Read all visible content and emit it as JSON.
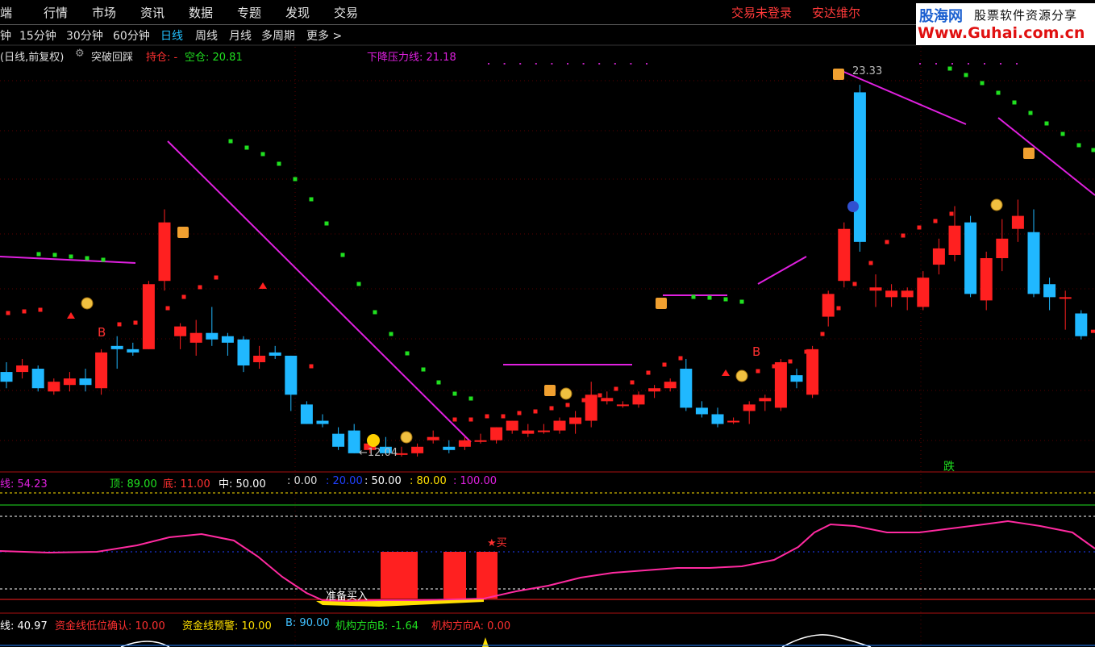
{
  "menu": {
    "items": [
      "端",
      "行情",
      "市场",
      "资讯",
      "数据",
      "专题",
      "发现",
      "交易"
    ],
    "status": [
      "交易未登录",
      "安达维尔"
    ]
  },
  "logo": {
    "name": "股海网",
    "slogan": "股票软件资源分享",
    "url": "Www.Guhai.com.cn"
  },
  "periods": {
    "items": [
      "钟",
      "15分钟",
      "30分钟",
      "60分钟",
      "日线",
      "周线",
      "月线",
      "多周期",
      "更多 >"
    ],
    "active": "日线"
  },
  "main_chart": {
    "header": {
      "title": "(日线,前复权)",
      "indicator": "突破回踩",
      "hold": "持仓: -",
      "empty": "空仓: 20.81",
      "pressure": "下降压力线: 21.18"
    },
    "high_label": "23.33",
    "low_label": "←12.04",
    "fall_label": "跌",
    "b_label": "B"
  },
  "sub1": {
    "labels": [
      "线: 54.23",
      "顶: 89.00",
      "底: 11.00",
      "中: 50.00",
      ": 0.00",
      ": 20.00",
      ": 50.00",
      ": 80.00",
      ": 100.00"
    ],
    "prep_label": "准备买入",
    "buy_label": "★买"
  },
  "sub2": {
    "labels": [
      "线: 40.97",
      "资金线低位确认: 10.00",
      "资金线预警: 10.00",
      "B: 90.00",
      "机构方向B: -1.64",
      "机构方向A: 0.00"
    ]
  },
  "colors": {
    "up": "#ff2020",
    "down": "#20b8ff",
    "magenta": "#e020e0",
    "green": "#20e020",
    "cyan": "#40c0ff",
    "bg": "#000000"
  },
  "chart_data": {
    "type": "candlestick",
    "title": "",
    "ylim": [
      11.5,
      24.5
    ],
    "candles": [
      {
        "o": 14.5,
        "h": 14.8,
        "l": 14.0,
        "c": 14.2
      },
      {
        "o": 14.5,
        "h": 14.9,
        "l": 14.3,
        "c": 14.7
      },
      {
        "o": 14.6,
        "h": 14.7,
        "l": 13.9,
        "c": 14.0
      },
      {
        "o": 13.9,
        "h": 14.3,
        "l": 13.8,
        "c": 14.2
      },
      {
        "o": 14.1,
        "h": 14.5,
        "l": 13.9,
        "c": 14.3
      },
      {
        "o": 14.3,
        "h": 14.6,
        "l": 13.9,
        "c": 14.1
      },
      {
        "o": 14.0,
        "h": 15.2,
        "l": 13.8,
        "c": 15.1
      },
      {
        "o": 15.3,
        "h": 15.6,
        "l": 14.6,
        "c": 15.2
      },
      {
        "o": 15.2,
        "h": 15.4,
        "l": 15.0,
        "c": 15.1
      },
      {
        "o": 15.2,
        "h": 17.3,
        "l": 15.2,
        "c": 17.2
      },
      {
        "o": 17.3,
        "h": 19.5,
        "l": 17.0,
        "c": 19.1
      },
      {
        "o": 15.6,
        "h": 16.0,
        "l": 15.2,
        "c": 15.9
      },
      {
        "o": 15.4,
        "h": 16.1,
        "l": 15.0,
        "c": 15.7
      },
      {
        "o": 15.7,
        "h": 16.5,
        "l": 15.3,
        "c": 15.5
      },
      {
        "o": 15.6,
        "h": 15.7,
        "l": 15.0,
        "c": 15.4
      },
      {
        "o": 15.5,
        "h": 15.6,
        "l": 14.5,
        "c": 14.7
      },
      {
        "o": 14.8,
        "h": 15.3,
        "l": 14.6,
        "c": 15.0
      },
      {
        "o": 15.1,
        "h": 15.3,
        "l": 14.9,
        "c": 15.0
      },
      {
        "o": 15.0,
        "h": 15.0,
        "l": 13.3,
        "c": 13.8
      },
      {
        "o": 13.5,
        "h": 13.6,
        "l": 12.9,
        "c": 12.9
      },
      {
        "o": 13.0,
        "h": 13.2,
        "l": 12.8,
        "c": 12.9
      },
      {
        "o": 12.6,
        "h": 12.8,
        "l": 12.1,
        "c": 12.2
      },
      {
        "o": 12.7,
        "h": 12.9,
        "l": 12.0,
        "c": 12.0
      },
      {
        "o": 12.1,
        "h": 12.4,
        "l": 12.0,
        "c": 12.3
      },
      {
        "o": 12.2,
        "h": 12.5,
        "l": 12.0,
        "c": 12.0
      },
      {
        "o": 12.0,
        "h": 12.2,
        "l": 11.9,
        "c": 12.0
      },
      {
        "o": 12.0,
        "h": 12.3,
        "l": 11.9,
        "c": 12.2
      },
      {
        "o": 12.4,
        "h": 12.7,
        "l": 12.3,
        "c": 12.5
      },
      {
        "o": 12.2,
        "h": 12.4,
        "l": 12.0,
        "c": 12.1
      },
      {
        "o": 12.2,
        "h": 12.5,
        "l": 12.1,
        "c": 12.4
      },
      {
        "o": 12.4,
        "h": 12.6,
        "l": 12.3,
        "c": 12.4
      },
      {
        "o": 12.4,
        "h": 12.8,
        "l": 12.3,
        "c": 12.8
      },
      {
        "o": 12.7,
        "h": 13.0,
        "l": 12.6,
        "c": 13.0
      },
      {
        "o": 12.6,
        "h": 12.9,
        "l": 12.5,
        "c": 12.7
      },
      {
        "o": 12.7,
        "h": 12.9,
        "l": 12.6,
        "c": 12.7
      },
      {
        "o": 12.7,
        "h": 13.1,
        "l": 12.6,
        "c": 13.0
      },
      {
        "o": 12.9,
        "h": 13.3,
        "l": 12.6,
        "c": 13.1
      },
      {
        "o": 13.0,
        "h": 14.2,
        "l": 12.8,
        "c": 13.8
      },
      {
        "o": 13.6,
        "h": 13.9,
        "l": 13.5,
        "c": 13.7
      },
      {
        "o": 13.5,
        "h": 13.6,
        "l": 13.4,
        "c": 13.5
      },
      {
        "o": 13.5,
        "h": 13.9,
        "l": 13.4,
        "c": 13.8
      },
      {
        "o": 13.9,
        "h": 14.1,
        "l": 13.7,
        "c": 14.0
      },
      {
        "o": 14.0,
        "h": 14.3,
        "l": 13.9,
        "c": 14.2
      },
      {
        "o": 14.6,
        "h": 14.9,
        "l": 13.3,
        "c": 13.4
      },
      {
        "o": 13.4,
        "h": 13.6,
        "l": 13.1,
        "c": 13.2
      },
      {
        "o": 13.2,
        "h": 13.4,
        "l": 12.8,
        "c": 12.9
      },
      {
        "o": 13.0,
        "h": 13.1,
        "l": 12.9,
        "c": 13.0
      },
      {
        "o": 13.3,
        "h": 13.6,
        "l": 12.9,
        "c": 13.5
      },
      {
        "o": 13.6,
        "h": 13.8,
        "l": 13.3,
        "c": 13.7
      },
      {
        "o": 13.4,
        "h": 14.9,
        "l": 13.3,
        "c": 14.8
      },
      {
        "o": 14.4,
        "h": 14.6,
        "l": 14.0,
        "c": 14.2
      },
      {
        "o": 13.8,
        "h": 15.3,
        "l": 13.7,
        "c": 15.2
      },
      {
        "o": 16.2,
        "h": 17.0,
        "l": 15.9,
        "c": 16.9
      },
      {
        "o": 17.3,
        "h": 19.1,
        "l": 17.1,
        "c": 18.9
      },
      {
        "o": 23.1,
        "h": 23.33,
        "l": 18.2,
        "c": 18.5
      },
      {
        "o": 17.0,
        "h": 17.5,
        "l": 16.5,
        "c": 17.1
      },
      {
        "o": 16.8,
        "h": 17.2,
        "l": 16.5,
        "c": 17.0
      },
      {
        "o": 16.8,
        "h": 17.1,
        "l": 16.4,
        "c": 17.0
      },
      {
        "o": 16.5,
        "h": 17.6,
        "l": 16.4,
        "c": 17.4
      },
      {
        "o": 17.8,
        "h": 18.6,
        "l": 17.5,
        "c": 18.3
      },
      {
        "o": 18.1,
        "h": 19.6,
        "l": 17.9,
        "c": 19.0
      },
      {
        "o": 19.1,
        "h": 19.3,
        "l": 16.8,
        "c": 16.9
      },
      {
        "o": 16.7,
        "h": 18.2,
        "l": 16.4,
        "c": 18.0
      },
      {
        "o": 18.0,
        "h": 19.2,
        "l": 17.6,
        "c": 18.6
      },
      {
        "o": 18.9,
        "h": 19.8,
        "l": 18.5,
        "c": 19.3
      },
      {
        "o": 18.8,
        "h": 19.5,
        "l": 16.8,
        "c": 16.9
      },
      {
        "o": 17.2,
        "h": 17.4,
        "l": 16.4,
        "c": 16.8
      },
      {
        "o": 16.8,
        "h": 17.0,
        "l": 15.8,
        "c": 16.8
      },
      {
        "o": 16.3,
        "h": 16.4,
        "l": 15.5,
        "c": 15.6
      },
      {
        "o": 15.7,
        "h": 16.0,
        "l": 15.5,
        "c": 15.8
      }
    ]
  }
}
